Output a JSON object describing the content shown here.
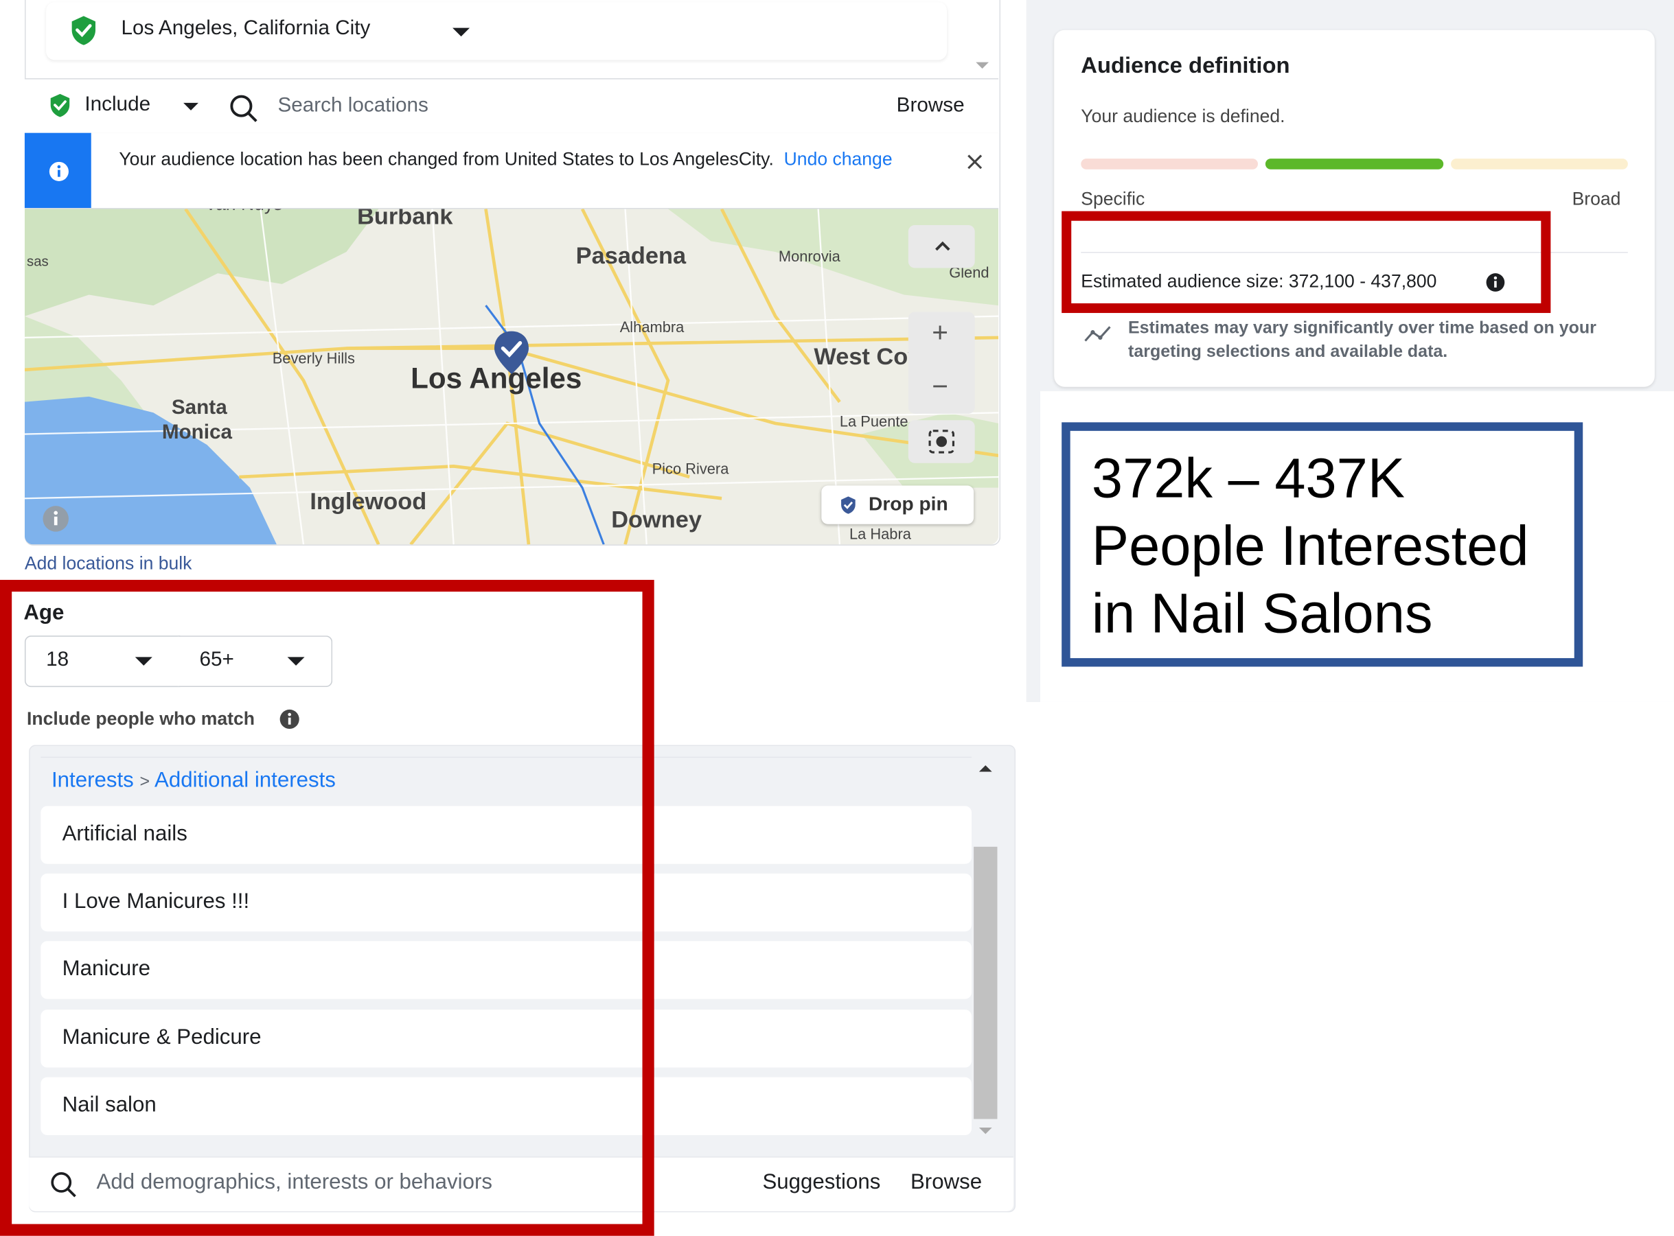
{
  "location": {
    "selected": "Los Angeles, California City",
    "include_label": "Include",
    "search_placeholder": "Search locations",
    "browse_label": "Browse",
    "notice": "Your audience location has been changed from United States to Los AngelesCity.",
    "undo_label": "Undo change",
    "add_bulk": "Add locations in bulk",
    "drop_pin": "Drop pin"
  },
  "map": {
    "labels": [
      "Burbank",
      "Van Nuys",
      "Pasadena",
      "Monrovia",
      "Glend",
      "sas",
      "Alhambra",
      "Beverly Hills",
      "Los Angeles",
      "West Covina",
      "Santa",
      "Monica",
      "La Puente",
      "Pico Rivera",
      "Inglewood",
      "Downey",
      "La Habra"
    ],
    "zoom_in": "+",
    "zoom_out": "−"
  },
  "age": {
    "label": "Age",
    "min": "18",
    "max": "65+"
  },
  "targeting": {
    "include_match": "Include people who match",
    "crumb_root": "Interests",
    "crumb_sep": ">",
    "crumb_leaf": "Additional interests",
    "interests": [
      "Artificial nails",
      "I Love Manicures !!!",
      "Manicure",
      "Manicure & Pedicure",
      "Nail salon"
    ],
    "search_placeholder": "Add demographics, interests or behaviors",
    "suggestions_label": "Suggestions",
    "browse_label": "Browse"
  },
  "audience": {
    "title": "Audience definition",
    "status": "Your audience is defined.",
    "specific": "Specific",
    "broad": "Broad",
    "size": "Estimated audience size: 372,100 - 437,800",
    "note": "Estimates may vary significantly over time based on your targeting selections and available data.",
    "bar_colors": [
      "#f9dcd6",
      "#5cb82a",
      "#fcefcf"
    ]
  },
  "callout": {
    "line1": "372k – 437K",
    "line2": "People Interested",
    "line3": "in Nail Salons"
  },
  "colors": {
    "red_highlight": "#c00000",
    "blue_callout": "#2f5597",
    "accent": "#1877f2",
    "green_check": "#1e9e3e"
  }
}
